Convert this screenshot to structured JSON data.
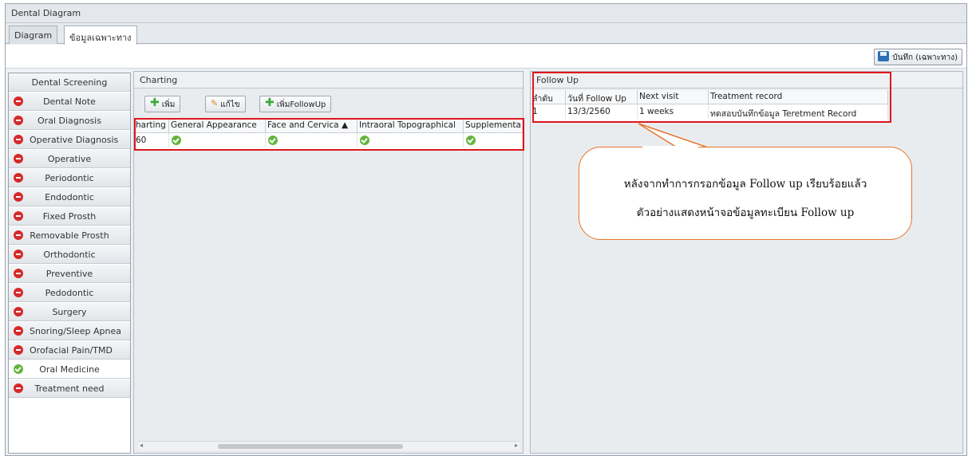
{
  "window": {
    "title": "Dental Diagram"
  },
  "tabs": [
    {
      "label": "Diagram"
    },
    {
      "label": "ข้อมูลเฉพาะทาง"
    }
  ],
  "toolbar": {
    "save_label": "บันทึก (เฉพาะทาง)"
  },
  "sidebar": {
    "items": [
      {
        "label": "Dental Screening",
        "status": "none"
      },
      {
        "label": "Dental Note",
        "status": "red"
      },
      {
        "label": "Oral Diagnosis",
        "status": "red"
      },
      {
        "label": "Operative Diagnosis",
        "status": "red"
      },
      {
        "label": "Operative",
        "status": "red"
      },
      {
        "label": "Periodontic",
        "status": "red"
      },
      {
        "label": "Endodontic",
        "status": "red"
      },
      {
        "label": "Fixed Prosth",
        "status": "red"
      },
      {
        "label": "Removable Prosth",
        "status": "red"
      },
      {
        "label": "Orthodontic",
        "status": "red"
      },
      {
        "label": "Preventive",
        "status": "red"
      },
      {
        "label": "Pedodontic",
        "status": "red"
      },
      {
        "label": "Surgery",
        "status": "red"
      },
      {
        "label": "Snoring/Sleep Apnea",
        "status": "red"
      },
      {
        "label": "Orofacial Pain/TMD",
        "status": "red"
      },
      {
        "label": "Oral Medicine",
        "status": "green"
      },
      {
        "label": "Treatment need",
        "status": "red"
      }
    ]
  },
  "charting": {
    "title": "Charting",
    "buttons": {
      "add": "เพิ่ม",
      "edit": "แก้ไข",
      "add_followup": "เพิ่มFollowUp"
    },
    "columns": [
      "harting",
      "General Appearance",
      "Face and Cervica ▲",
      "Intraoral Topographical",
      "Supplementa"
    ],
    "row": {
      "first": "60",
      "checks": [
        "green",
        "green",
        "green",
        "green"
      ]
    }
  },
  "followup": {
    "title": "Follow Up",
    "columns": [
      "ลำดับ",
      "วันที่ Follow Up",
      "Next visit",
      "Treatment record"
    ],
    "rows": [
      {
        "no": "1",
        "date": "13/3/2560",
        "next": "1 weeks",
        "record": "ทดสอบบันทึกข้อมูล Teretment Record"
      }
    ]
  },
  "callout": {
    "line1": "หลังจากทำการกรอกข้อมูล Follow up เรียบร้อยแล้ว",
    "line2": "ตัวอย่างแสดงหน้าจอข้อมูลทะเบียน Follow up"
  },
  "colors": {
    "highlight": "#e0161c",
    "callout_border": "#e8742a",
    "status_red": "#d42a2a",
    "status_green": "#62b53c"
  }
}
